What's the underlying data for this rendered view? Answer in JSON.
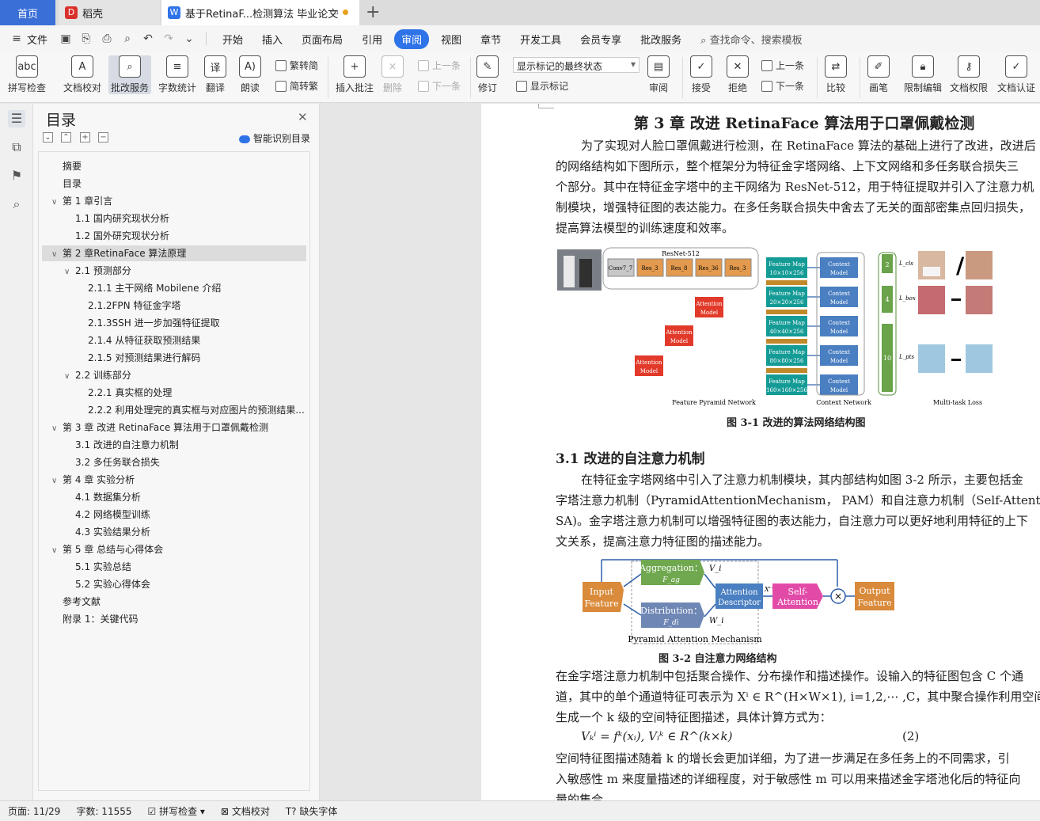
{
  "tabs": {
    "home": "首页",
    "daoke": "稻壳",
    "doc": "基于RetinaF...检测算法 毕业论文"
  },
  "menu": {
    "file": "文件",
    "items": [
      "开始",
      "插入",
      "页面布局",
      "引用",
      "审阅",
      "视图",
      "章节",
      "开发工具",
      "会员专享",
      "批改服务"
    ],
    "active": "审阅",
    "search": "查找命令、搜索模板"
  },
  "ribbon": {
    "spellcheck": "拼写检查",
    "doc_check": "文档校对",
    "review_service": "批改服务",
    "word_count": "字数统计",
    "translate": "翻译",
    "read_aloud": "朗读",
    "trad": "繁转简",
    "simp": "简转繁",
    "insert_comment": "插入批注",
    "delete": "删除",
    "prev_comment": "上一条",
    "next_comment": "下一条",
    "track": "修订",
    "markup_select": "显示标记的最终状态",
    "show_markup": "显示标记",
    "review": "审阅",
    "accept": "接受",
    "reject": "拒绝",
    "prev_change": "上一条",
    "next_change": "下一条",
    "compare": "比较",
    "ink": "画笔",
    "restrict": "限制编辑",
    "permission": "文档权限",
    "certify": "文档认证"
  },
  "outline": {
    "title": "目录",
    "smart": "智能识别目录",
    "items": [
      {
        "text": "摘要",
        "level": 0,
        "arrow": ""
      },
      {
        "text": "目录",
        "level": 0,
        "arrow": ""
      },
      {
        "text": "第 1 章引言",
        "level": 0,
        "arrow": "∨"
      },
      {
        "text": "1.1 国内研究现状分析",
        "level": 1,
        "arrow": ""
      },
      {
        "text": "1.2 国外研究现状分析",
        "level": 1,
        "arrow": ""
      },
      {
        "text": "第 2 章RetinaFace 算法原理",
        "level": 0,
        "arrow": "∨",
        "selected": true
      },
      {
        "text": "2.1 预测部分",
        "level": 1,
        "arrow": "∨"
      },
      {
        "text": "2.1.1 主干网络 Mobilene 介绍",
        "level": 2,
        "arrow": ""
      },
      {
        "text": "2.1.2FPN 特征金字塔",
        "level": 2,
        "arrow": ""
      },
      {
        "text": "2.1.3SSH 进一步加强特征提取",
        "level": 2,
        "arrow": ""
      },
      {
        "text": "2.1.4 从特征获取预测结果",
        "level": 2,
        "arrow": ""
      },
      {
        "text": "2.1.5 对预测结果进行解码",
        "level": 2,
        "arrow": ""
      },
      {
        "text": "2.2 训练部分",
        "level": 1,
        "arrow": "∨"
      },
      {
        "text": "2.2.1 真实框的处理",
        "level": 2,
        "arrow": ""
      },
      {
        "text": "2.2.2 利用处理完的真实框与对应图片的预测结果...",
        "level": 2,
        "arrow": ""
      },
      {
        "text": "第 3 章 改进 RetinaFace 算法用于口罩佩戴检测",
        "level": 0,
        "arrow": "∨"
      },
      {
        "text": "3.1 改进的自注意力机制",
        "level": 1,
        "arrow": ""
      },
      {
        "text": "3.2 多任务联合损失",
        "level": 1,
        "arrow": ""
      },
      {
        "text": "第 4 章 实验分析",
        "level": 0,
        "arrow": "∨"
      },
      {
        "text": "4.1 数据集分析",
        "level": 1,
        "arrow": ""
      },
      {
        "text": "4.2 网络模型训练",
        "level": 1,
        "arrow": ""
      },
      {
        "text": "4.3 实验结果分析",
        "level": 1,
        "arrow": ""
      },
      {
        "text": "第 5 章 总结与心得体会",
        "level": 0,
        "arrow": "∨"
      },
      {
        "text": "5.1 实验总结",
        "level": 1,
        "arrow": ""
      },
      {
        "text": "5.2 实验心得体会",
        "level": 1,
        "arrow": ""
      },
      {
        "text": "参考文献",
        "level": 0,
        "arrow": ""
      },
      {
        "text": "附录 1：关键代码",
        "level": 0,
        "arrow": ""
      }
    ]
  },
  "page": {
    "chapter_title": "第 3 章  改进 RetinaFace 算法用于口罩佩戴检测",
    "intro_lines": [
      "为了实现对人脸口罩佩戴进行检测，在 RetinaFace 算法的基础上进行了改进，改进后",
      "的网络结构如下图所示，整个框架分为特征金字塔网络、上下文网络和多任务联合损失三",
      "个部分。其中在特征金字塔中的主干网络为 ResNet-512，用于特征提取并引入了注意力机",
      "制模块，增强特征图的表达能力。在多任务联合损失中舍去了无关的面部密集点回归损失，",
      "提高算法模型的训练速度和效率。"
    ],
    "fig1": {
      "backbone_label": "ResNet-512",
      "blocks": [
        "Conv7_7",
        "Res_3",
        "Res_8",
        "Res_36",
        "Res_3"
      ],
      "feature_maps": [
        "Feature Map 10×10×256",
        "Feature Map 20×20×256",
        "Feature Map 40×40×256",
        "Feature Map 80×80×256",
        "Feature Map 160×160×256"
      ],
      "context": "Context Model",
      "attention": "Attention Model",
      "fpn_label": "Feature  Pyramid  Network",
      "ctx_label": "Context  Network",
      "loss_label": "Multi-task  Loss",
      "loss_nums": [
        "2",
        "4",
        "10"
      ],
      "loss_names": [
        "L_cls",
        "L_box",
        "L_pts"
      ],
      "caption": "图 3-1  改进的算法网络结构图"
    },
    "section_title": "3.1 改进的自注意力机制",
    "sec_lines": [
      "在特征金字塔网络中引入了注意力机制模块，其内部结构如图 3-2 所示，主要包括金",
      "字塔注意力机制（PyramidAttentionMechanism， PAM）和自注意力机制（Self-Attention，",
      "SA)。金字塔注意力机制可以增强特征图的表达能力，自注意力可以更好地利用特征的上下",
      "文关系，提高注意力特征图的描述能力。"
    ],
    "fig2": {
      "input": "Input Feature",
      "aggregation": "Aggregation：",
      "distribution": "Distribution：",
      "descriptor": "Attention Descriptor",
      "self_attention": "Self-Attention",
      "output": "Output Feature",
      "pam": "Pyramid  Attention  Mechanism",
      "caption": "图 3-2       自注意力网络结构"
    },
    "body_lines": [
      "在金字塔注意力机制中包括聚合操作、分布操作和描述操作。设输入的特征图包含 C 个通",
      "道，其中的单个通道特征可表示为 Xⁱ ∈ R^(H×W×1), i=1,2,⋯ ,C，其中聚合操作利用空间池化",
      "生成一个 k 级的空间特征图描述，具体计算方式为："
    ],
    "formula": "Vₖⁱ = fᵏ(xᵢ), Vᵢᵏ ∈ R^(k×k)",
    "formula_no": "(2)",
    "tail_lines": [
      "空间特征图描述随着 k 的增长会更加详细，为了进一步满足在多任务上的不同需求，引",
      "入敏感性 m 来度量描述的详细程度，对于敏感性 m 可以用来描述金字塔池化后的特征向",
      "量的集合。"
    ]
  },
  "status": {
    "page": "页面: 11/29",
    "words": "字数: 11555",
    "spell": "拼写检查",
    "proof": "文档校对",
    "font": "缺失字体"
  }
}
